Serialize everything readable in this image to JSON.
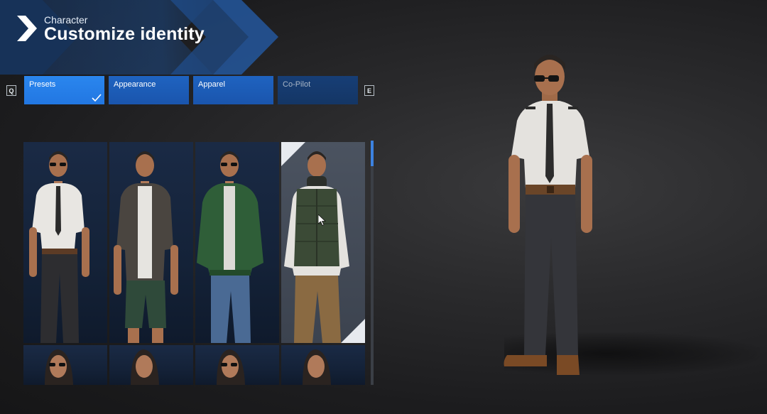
{
  "header": {
    "subtitle": "Character",
    "title": "Customize identity"
  },
  "keys": {
    "prev": "Q",
    "next": "E"
  },
  "tabs": [
    {
      "label": "Presets",
      "state": "active"
    },
    {
      "label": "Appearance",
      "state": "normal"
    },
    {
      "label": "Apparel",
      "state": "normal"
    },
    {
      "label": "Co-Pilot",
      "state": "dim"
    }
  ],
  "colors": {
    "accent": "#2277e2",
    "tab": "#1a55ad",
    "tab_dim": "#143665",
    "card": "#142238",
    "card_selected": "#3c434f"
  },
  "presets": [
    {
      "outfit": "pilot-uniform",
      "selected": false
    },
    {
      "outfit": "casual-shorts",
      "selected": false
    },
    {
      "outfit": "bomber-jacket",
      "selected": false
    },
    {
      "outfit": "puffer-vest",
      "selected": true
    }
  ],
  "presets_row2": [
    {
      "outfit": "female-sunglasses"
    },
    {
      "outfit": "female"
    },
    {
      "outfit": "female-sunglasses"
    },
    {
      "outfit": "female"
    }
  ],
  "icons": {
    "chevron": "chevron-right-icon",
    "check": "checkmark-icon",
    "cursor": "mouse-cursor-icon"
  }
}
